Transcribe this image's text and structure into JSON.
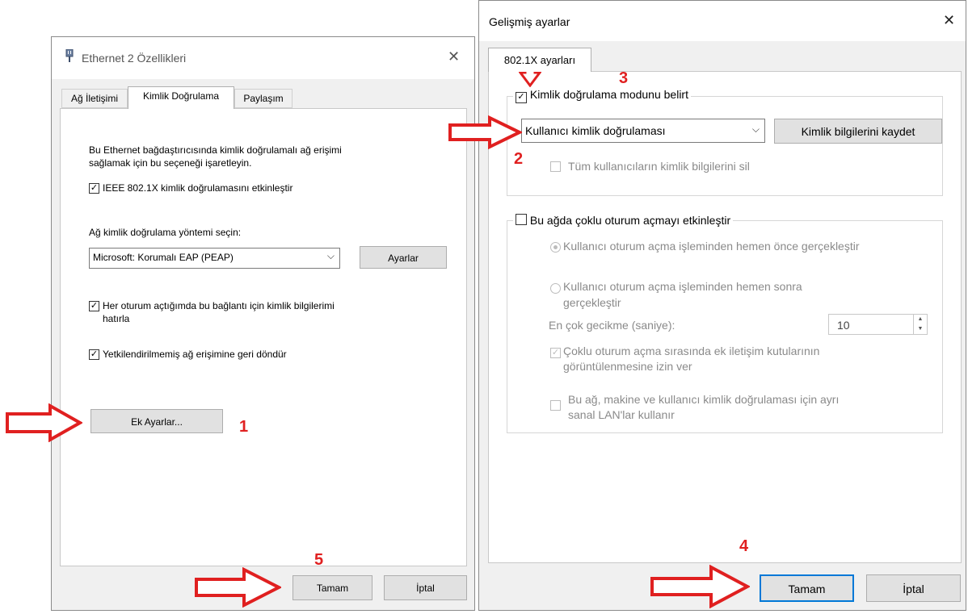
{
  "left_dialog": {
    "title": "Ethernet 2 Özellikleri",
    "close_glyph": "✕",
    "tabs": [
      {
        "label": "Ağ İletişimi"
      },
      {
        "label": "Kimlik Doğrulama"
      },
      {
        "label": "Paylaşım"
      }
    ],
    "description_line1": "Bu Ethernet bağdaştırıcısında kimlik doğrulamalı ağ erişimi",
    "description_line2": "sağlamak için bu seçeneği işaretleyin.",
    "ieee_checkbox_label": "IEEE 802.1X kimlik doğrulamasını etkinleştir",
    "method_label": "Ağ kimlik doğrulama yöntemi seçin:",
    "method_value": "Microsoft: Korumalı EAP (PEAP)",
    "settings_button": "Ayarlar",
    "remember_label_line1": "Her oturum açtığımda bu bağlantı için kimlik bilgilerimi",
    "remember_label_line2": "hatırla",
    "fallback_label": "Yetkilendirilmemiş ağ erişimine geri döndür",
    "additional_settings_button": "Ek Ayarlar...",
    "ok_button": "Tamam",
    "cancel_button": "İptal"
  },
  "right_dialog": {
    "title": "Gelişmiş ayarlar",
    "close_glyph": "✕",
    "tab_label": "802.1X ayarları",
    "specify_mode_label": "Kimlik doğrulama modunu belirt",
    "auth_mode_value": "Kullanıcı kimlik doğrulaması",
    "save_credentials_button": "Kimlik bilgilerini kaydet",
    "delete_credentials_label": "Tüm kullanıcıların kimlik bilgilerini sil",
    "sso_label": "Bu ağda çoklu oturum açmayı etkinleştir",
    "radio_before": "Kullanıcı oturum açma işleminden hemen önce gerçekleştir",
    "radio_after_line1": "Kullanıcı oturum açma işleminden hemen sonra",
    "radio_after_line2": "gerçekleştir",
    "max_delay_label": "En çok gecikme (saniye):",
    "max_delay_value": "10",
    "allow_dialogs_line1": "Çoklu oturum açma sırasında ek iletişim kutularının",
    "allow_dialogs_line2": "görüntülenmesine izin ver",
    "separate_vlan_line1": "Bu ağ, makine ve kullanıcı kimlik doğrulaması için ayrı",
    "separate_vlan_line2": "sanal LAN'lar kullanır",
    "ok_button": "Tamam",
    "cancel_button": "İptal"
  },
  "annotations": {
    "step1": "1",
    "step2": "2",
    "step3": "3",
    "step4": "4",
    "step5": "5"
  },
  "colors": {
    "annotation_red": "#e02020",
    "focus_blue": "#0078d7",
    "dialog_bg": "#f0f0f0"
  },
  "icons": {
    "ethernet": "ethernet-adapter-icon",
    "checkmark": "✓",
    "chevron": "chevron-down-icon"
  }
}
